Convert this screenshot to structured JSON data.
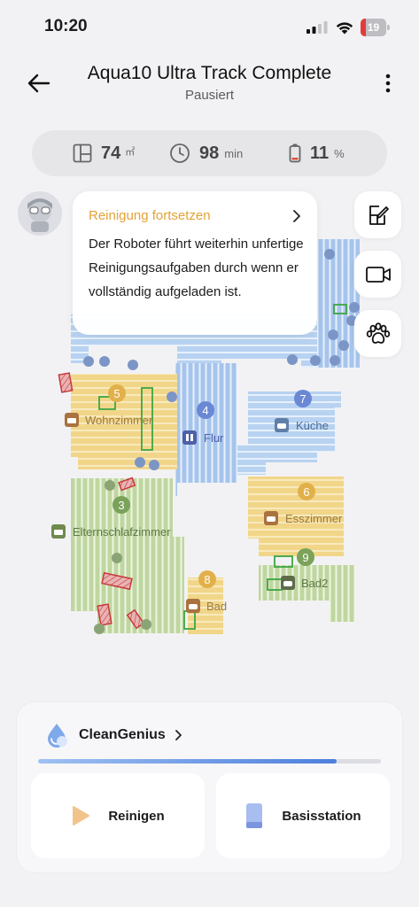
{
  "status_bar": {
    "time": "10:20",
    "battery_level": "19",
    "battery_fraction": 0.19
  },
  "header": {
    "title": "Aqua10 Ultra Track Complete",
    "subtitle": "Pausiert",
    "back_icon": "arrow-left-icon",
    "more_icon": "more-vertical-icon"
  },
  "stats": {
    "area_value": "74",
    "area_unit": "㎡",
    "time_value": "98",
    "time_unit": "min",
    "battery_value": "11",
    "battery_unit": "%"
  },
  "message": {
    "title": "Reinigung fortsetzen",
    "text": "Der Roboter führt weiterhin unfertige Reinigungsaufgaben durch wenn er vollständig aufgeladen ist."
  },
  "side_buttons": [
    "edit-map-icon",
    "video-camera-icon",
    "pet-paw-icon"
  ],
  "map": {
    "rooms": [
      {
        "name": "Wohnzimmer",
        "number": "5"
      },
      {
        "name": "Flur",
        "number": "4"
      },
      {
        "name": "Küche",
        "number": "7"
      },
      {
        "name": "Esszimmer",
        "number": "6"
      },
      {
        "name": "Elternschlafzimmer",
        "number": "3"
      },
      {
        "name": "Bad",
        "number": "8"
      },
      {
        "name": "Bad2",
        "number": "9"
      }
    ]
  },
  "panel": {
    "clean_genius": "CleanGenius",
    "progress": 0.87,
    "start_label": "Reinigen",
    "station_label": "Basisstation"
  },
  "colors": {
    "accent_orange": "#e3a236",
    "progress_blue": "#4d7fdc",
    "room_blue": "#a9c7ee",
    "room_yellow": "#f1d17b",
    "room_green": "#bcd49a"
  }
}
